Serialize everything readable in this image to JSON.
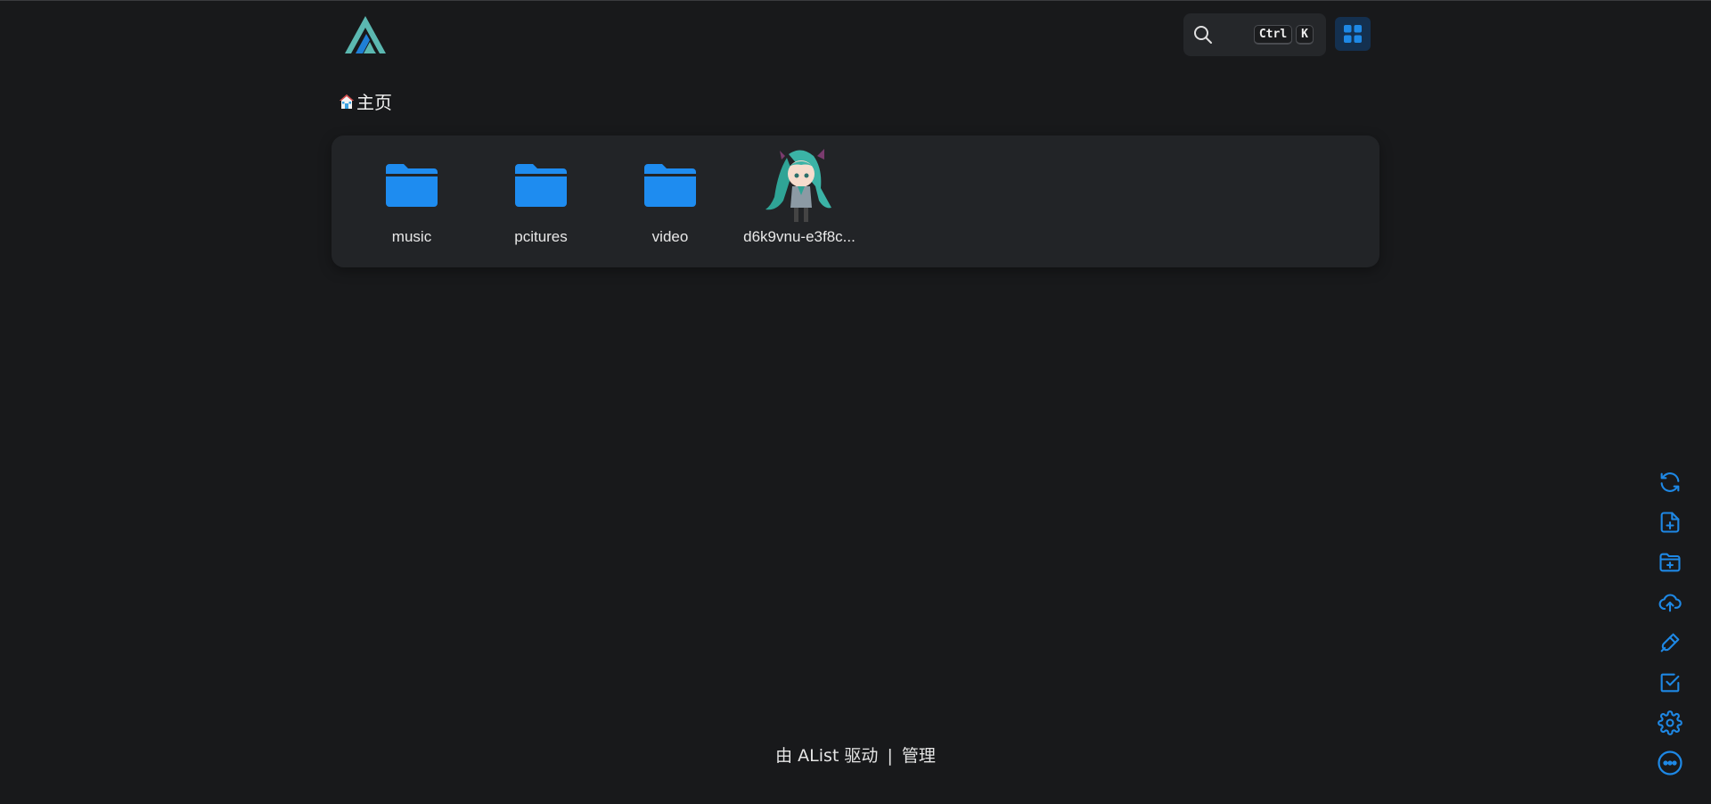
{
  "header": {
    "logo_icon": "alist-logo",
    "search": {
      "icon": "search-icon",
      "kbd_ctrl": "Ctrl",
      "kbd_k": "K"
    },
    "layout_toggle_icon": "grid-layout-icon"
  },
  "breadcrumb": {
    "icon": "home-icon",
    "label": "主页"
  },
  "files": [
    {
      "name": "music",
      "type": "folder"
    },
    {
      "name": "pcitures",
      "type": "folder"
    },
    {
      "name": "video",
      "type": "folder"
    },
    {
      "name": "d6k9vnu-e3f8c...",
      "type": "image"
    }
  ],
  "footer": {
    "powered_by": "由 AList 驱动",
    "separator": "|",
    "manage": "管理"
  },
  "side_tools": [
    "refresh-icon",
    "new-file-icon",
    "new-folder-icon",
    "upload-icon",
    "offline-download-icon",
    "select-icon",
    "settings-icon",
    "more-icon"
  ],
  "colors": {
    "accent": "#1e88e5",
    "background": "#18191b",
    "panel": "#222427",
    "folder": "#1e8cf0",
    "logo_teal": "#5bb8b1",
    "logo_blue": "#1f7fd6"
  }
}
